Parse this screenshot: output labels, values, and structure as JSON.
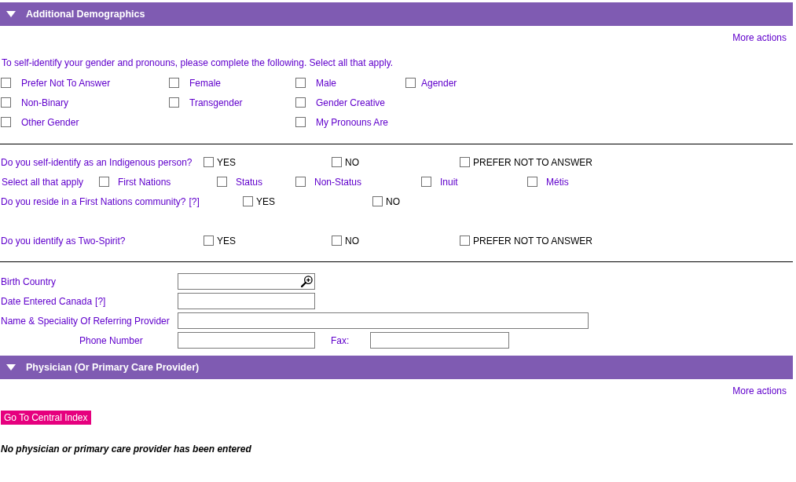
{
  "sections": [
    {
      "kind": "demographics",
      "title": "Additional Demographics",
      "expanded": true,
      "more_actions": "More actions",
      "gender": {
        "prompt": "To self-identify your gender and pronouns, please complete the following. Select all that apply.",
        "columns": [
          [
            {
              "label": "Prefer Not To Answer",
              "checked": false
            },
            {
              "label": "Non-Binary",
              "checked": false
            },
            {
              "label": "Other Gender",
              "checked": false
            }
          ],
          [
            {
              "label": "Female",
              "checked": false
            },
            {
              "label": "Transgender",
              "checked": false
            }
          ],
          [
            {
              "label": "Male",
              "checked": false
            },
            {
              "label": "Gender Creative",
              "checked": false
            },
            {
              "label": "My Pronouns Are",
              "checked": false
            }
          ],
          [
            {
              "label": "Agender",
              "checked": false
            }
          ]
        ]
      },
      "indigenous": [
        {
          "kind": "question",
          "label": "Do you self-identify as an Indigenous person?",
          "options": [
            {
              "label": "YES",
              "checked": false
            },
            {
              "label": "NO",
              "checked": false
            },
            {
              "label": "PREFER NOT TO ANSWER",
              "checked": false
            }
          ]
        },
        {
          "kind": "multi",
          "label": "Select all that apply",
          "options": [
            {
              "label": "First Nations",
              "checked": false
            },
            {
              "label": "Status",
              "checked": false
            },
            {
              "label": "Non-Status",
              "checked": false
            },
            {
              "label": "Inuit",
              "checked": false
            },
            {
              "label": "Métis",
              "checked": false
            }
          ]
        },
        {
          "kind": "question",
          "label": "Do you reside in a First Nations community?",
          "help": "[?]",
          "options": [
            {
              "label": "YES",
              "checked": false
            },
            {
              "label": "NO",
              "checked": false
            }
          ]
        }
      ],
      "two_spirit": {
        "kind": "question",
        "label": "Do you identify as Two-Spirit?",
        "options": [
          {
            "label": "YES",
            "checked": false
          },
          {
            "label": "NO",
            "checked": false
          },
          {
            "label": "PREFER NOT TO ANSWER",
            "checked": false
          }
        ]
      },
      "fields": [
        {
          "kind": "lookup",
          "label": "Birth Country"
        },
        {
          "kind": "short",
          "label": "Date Entered Canada",
          "help": "[?]"
        },
        {
          "kind": "long",
          "label": "Name & Speciality Of Referring Provider"
        },
        {
          "kind": "pair",
          "label": "Phone Number",
          "second_label": "Fax:"
        }
      ]
    },
    {
      "kind": "physician",
      "title": "Physician (Or Primary Care Provider)",
      "expanded": true,
      "more_actions": "More actions",
      "button": "Go To Central Index",
      "message": "No physician or primary care provider has been entered"
    }
  ]
}
